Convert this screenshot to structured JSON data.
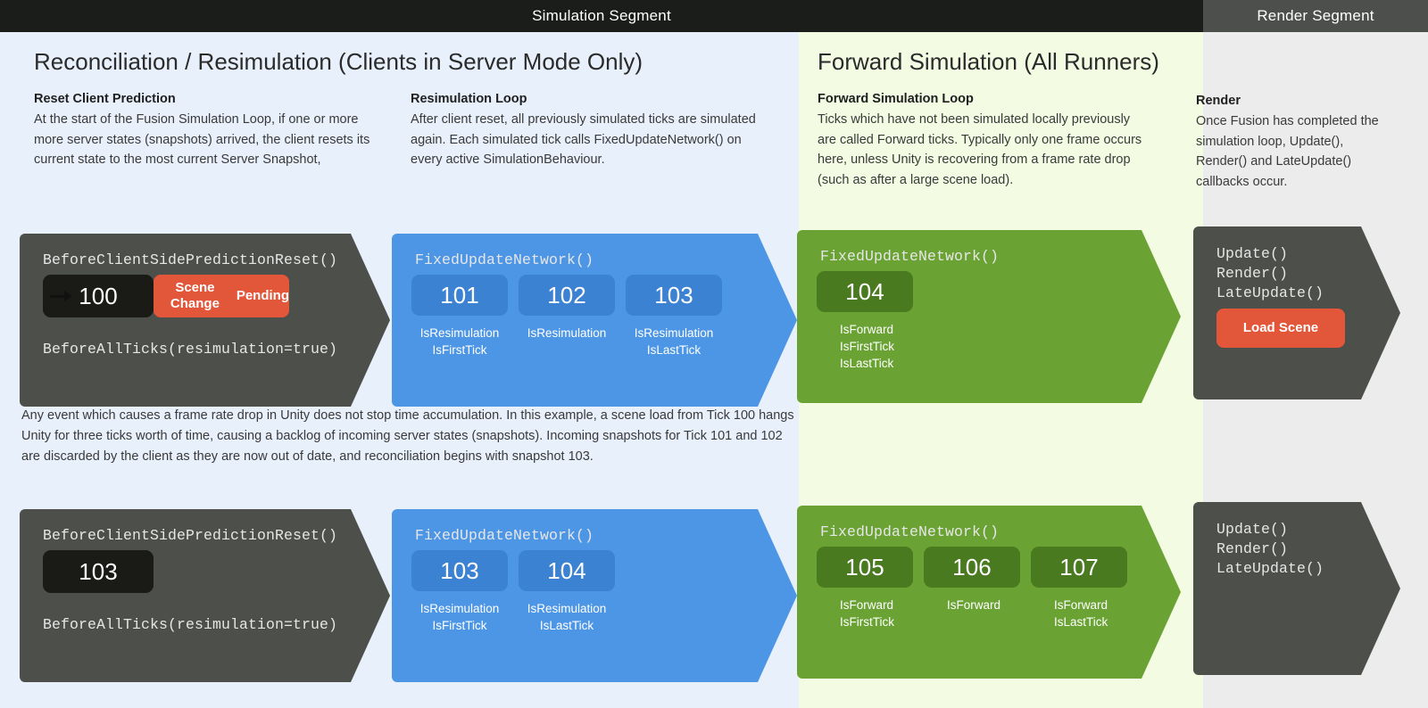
{
  "header": {
    "simulation_segment": "Simulation Segment",
    "render_segment": "Render Segment"
  },
  "sections": {
    "reconciliation": {
      "title": "Reconciliation / Resimulation (Clients in Server Mode Only)",
      "reset": {
        "heading": "Reset Client Prediction",
        "body": "At the start of the Fusion Simulation Loop, if one or more more server states (snapshots) arrived, the client resets its current state to the most current Server Snapshot,"
      },
      "resimulation": {
        "heading": "Resimulation Loop",
        "body": "After client reset, all previously simulated ticks are simulated again. Each simulated tick calls FixedUpdateNetwork() on every active SimulationBehaviour."
      }
    },
    "forward": {
      "title": "Forward Simulation (All Runners)",
      "loop": {
        "heading": "Forward Simulation Loop",
        "body": "Ticks which have not been simulated locally previously are called Forward ticks. Typically only one frame occurs here, unless Unity is recovering from a frame rate drop (such as after a large scene load)."
      }
    },
    "render": {
      "heading": "Render",
      "body": "Once Fusion has completed the simulation loop, Update(), Render() and LateUpdate() callbacks occur."
    }
  },
  "midnote": "Any event which causes a frame rate drop in Unity does not stop time accumulation. In this example, a scene load from Tick 100 hangs Unity for three ticks worth of time, causing a backlog of incoming server states (snapshots). Incoming snapshots for Tick 101 and 102 are discarded by the client as they are now out of date, and reconciliation begins with snapshot 103.",
  "rows": [
    {
      "reset_block": {
        "callback_top": "BeforeClientSidePredictionReset()",
        "tick": "100",
        "pill": "Scene Change\nPending",
        "callback_bottom": "BeforeAllTicks(resimulation=true)"
      },
      "resim_block": {
        "callback": "FixedUpdateNetwork()",
        "ticks": [
          {
            "tick": "101",
            "flags": [
              "IsResimulation",
              "IsFirstTick"
            ]
          },
          {
            "tick": "102",
            "flags": [
              "IsResimulation"
            ]
          },
          {
            "tick": "103",
            "flags": [
              "IsResimulation",
              "IsLastTick"
            ]
          }
        ]
      },
      "forward_block": {
        "callback": "FixedUpdateNetwork()",
        "ticks": [
          {
            "tick": "104",
            "flags": [
              "IsForward",
              "IsFirstTick",
              "IsLastTick"
            ]
          }
        ]
      },
      "render_block": {
        "callbacks": "Update()\nRender()\nLateUpdate()",
        "pill": "Load Scene"
      }
    },
    {
      "reset_block": {
        "callback_top": "BeforeClientSidePredictionReset()",
        "tick": "103",
        "pill": null,
        "callback_bottom": "BeforeAllTicks(resimulation=true)"
      },
      "resim_block": {
        "callback": "FixedUpdateNetwork()",
        "ticks": [
          {
            "tick": "103",
            "flags": [
              "IsResimulation",
              "IsFirstTick"
            ]
          },
          {
            "tick": "104",
            "flags": [
              "IsResimulation",
              "IsLastTick"
            ]
          }
        ]
      },
      "forward_block": {
        "callback": "FixedUpdateNetwork()",
        "ticks": [
          {
            "tick": "105",
            "flags": [
              "IsForward",
              "IsFirstTick"
            ]
          },
          {
            "tick": "106",
            "flags": [
              "IsForward"
            ]
          },
          {
            "tick": "107",
            "flags": [
              "IsForward",
              "IsLastTick"
            ]
          }
        ]
      },
      "render_block": {
        "callbacks": "Update()\nRender()\nLateUpdate()",
        "pill": null
      }
    }
  ],
  "colors": {
    "header_dark": "#1b1d1b",
    "header_render": "#4d4f4c",
    "recon_bg": "#e7f0fb",
    "forward_bg": "#f3fbe3",
    "render_bg": "#ececec",
    "block_dark": "#4d4f4a",
    "block_blue": "#4d96e6",
    "block_green": "#6aa333",
    "tick_dark": "#1a1a17",
    "tick_blue": "#3b82d2",
    "tick_green": "#4a7a1f",
    "accent_orange": "#e2563a"
  }
}
